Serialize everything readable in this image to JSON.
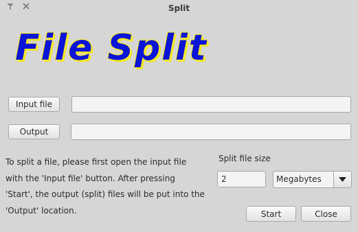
{
  "window": {
    "title": "Split",
    "pin_icon": "pin-icon",
    "close_icon": "close-icon"
  },
  "banner": {
    "text": "File Split",
    "text_color": "#0c14d6",
    "shadow_color": "#f6ea2a"
  },
  "input": {
    "button_label": "Input file",
    "value": ""
  },
  "output": {
    "button_label": "Output",
    "value": ""
  },
  "description": "To split a file, please first open the input file with the 'Input file' button. After pressing 'Start', the output (split) files will be put into the 'Output' location.",
  "split_size": {
    "label": "Split file size",
    "value": "2",
    "unit": "Megabytes",
    "dropdown_icon": "chevron-down-icon"
  },
  "actions": {
    "start_label": "Start",
    "close_label": "Close"
  }
}
